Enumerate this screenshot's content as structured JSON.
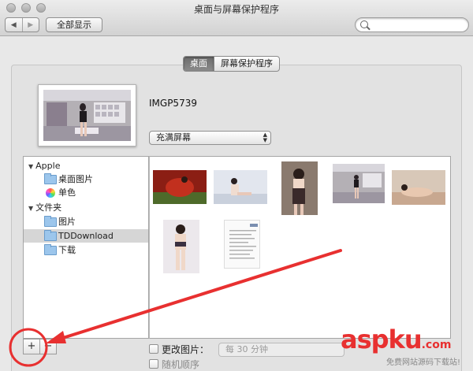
{
  "window": {
    "title": "桌面与屏幕保护程序"
  },
  "toolbar": {
    "back": "◀",
    "forward": "▶",
    "show_all": "全部显示"
  },
  "tabs": [
    {
      "label": "桌面",
      "active": true
    },
    {
      "label": "屏幕保护程序",
      "active": false
    }
  ],
  "preview": {
    "filename": "IMGP5739",
    "fill_mode": "充满屏幕"
  },
  "sidebar": {
    "apple_group": "Apple",
    "apple_items": [
      {
        "label": "桌面图片",
        "icon": "folder-icon"
      },
      {
        "label": "单色",
        "icon": "color-wheel-icon"
      }
    ],
    "folders_group": "文件夹",
    "folder_items": [
      {
        "label": "图片",
        "icon": "folder-icon"
      },
      {
        "label": "TDDownload",
        "icon": "folder-icon",
        "selected": true
      },
      {
        "label": "下载",
        "icon": "folder-icon"
      }
    ]
  },
  "bottom": {
    "add": "+",
    "remove": "−",
    "change_picture": "更改图片：",
    "interval": "每 30 分钟",
    "random_order": "随机顺序"
  },
  "watermark": {
    "brand_a": "asp",
    "brand_b": "ku",
    "brand_c": ".com",
    "sub": "免费网站源码下载站!"
  },
  "colors": {
    "annotation_red": "#e83030",
    "selected_row": "#d6d6d6"
  }
}
